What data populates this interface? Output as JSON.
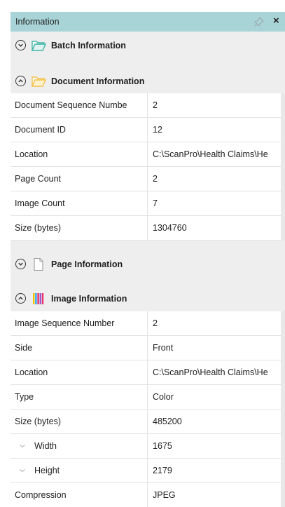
{
  "panel": {
    "title": "Information",
    "close_glyph": "×",
    "icons": {
      "pin": "pin-icon",
      "close": "close-icon"
    }
  },
  "sections": {
    "batch": {
      "title": "Batch Information",
      "state": "collapsed",
      "icon": "folder-open-icon",
      "icon_color": "#3fb4a6"
    },
    "document": {
      "title": "Document Information",
      "state": "expanded",
      "icon": "folder-icon",
      "icon_color": "#f5c24a",
      "rows": [
        {
          "key": "Document Sequence Numbe",
          "value": "2"
        },
        {
          "key": "Document ID",
          "value": "12"
        },
        {
          "key": "Location",
          "value": "C:\\ScanPro\\Health Claims\\He"
        },
        {
          "key": "Page Count",
          "value": "2"
        },
        {
          "key": "Image Count",
          "value": "7"
        },
        {
          "key": "Size (bytes)",
          "value": "1304760"
        }
      ]
    },
    "page": {
      "title": "Page Information",
      "state": "collapsed",
      "icon": "page-icon"
    },
    "image": {
      "title": "Image Information",
      "state": "expanded",
      "icon": "color-bars-icon",
      "rows": [
        {
          "key": "Image Sequence Number",
          "value": "2"
        },
        {
          "key": "Side",
          "value": "Front"
        },
        {
          "key": "Location",
          "value": "C:\\ScanPro\\Health Claims\\He"
        },
        {
          "key": "Type",
          "value": "Color"
        },
        {
          "key": "Size (bytes)",
          "value": "485200"
        },
        {
          "key": "Width",
          "value": "1675",
          "nested": true
        },
        {
          "key": "Height",
          "value": "2179",
          "nested": true
        },
        {
          "key": "Compression",
          "value": "JPEG"
        }
      ]
    }
  },
  "colors": {
    "titlebar": "#a9d4d7",
    "panel_bg": "#eeeeee",
    "row_bg": "#ffffff",
    "grid": "#e3e3e3"
  }
}
